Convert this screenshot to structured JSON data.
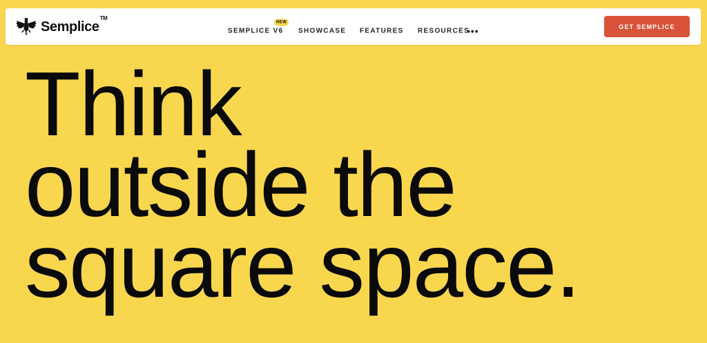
{
  "brand": {
    "name": "Semplice",
    "trademark": "TM",
    "logo_icon": "eagle-icon"
  },
  "nav": {
    "items": [
      {
        "label": "SEMPLICE V6",
        "badge": "NEW"
      },
      {
        "label": "SHOWCASE"
      },
      {
        "label": "FEATURES"
      },
      {
        "label": "RESOURCES"
      }
    ],
    "more_icon": "more-dots-icon",
    "more_glyph": "•••",
    "cta_label": "GET SEMPLICE"
  },
  "hero": {
    "lines": [
      "Think",
      "outside the",
      "square space."
    ]
  },
  "colors": {
    "background": "#F8D64E",
    "navbar": "#FFFFFF",
    "cta": "#D9533B",
    "text": "#0A0A0A"
  }
}
